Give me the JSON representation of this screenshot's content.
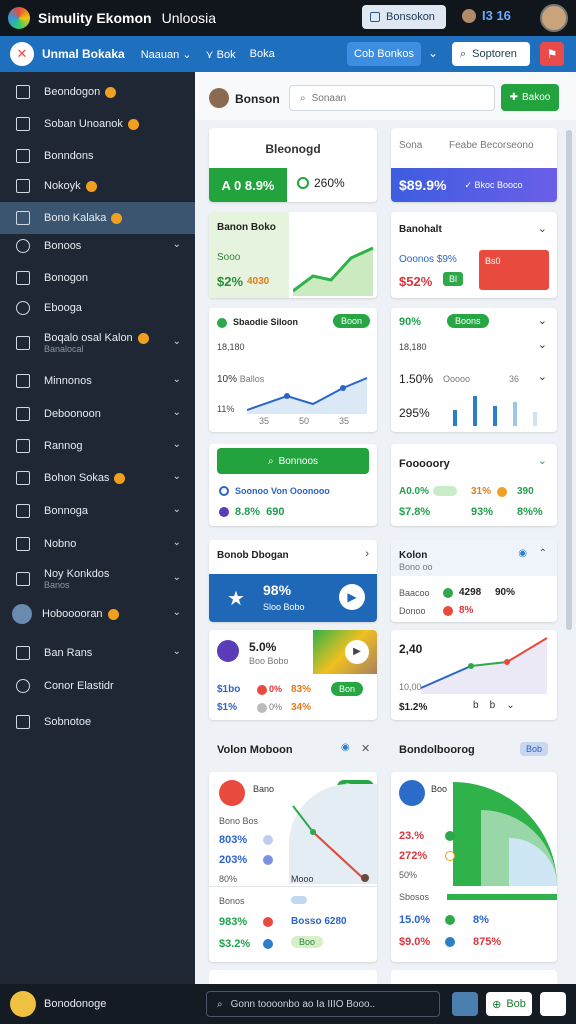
{
  "topbar": {
    "title": "Simulity Ekomon",
    "subtitle": "Unloosia",
    "button_label": "Bonsokon",
    "badge": "I3 16"
  },
  "navbar": {
    "brand": "Unmal Bokaka",
    "links": [
      "Naauan",
      "Bok",
      "Boka"
    ],
    "button_label": "Cob Bonkos",
    "search_label": "Soptoren"
  },
  "sidebar": {
    "items": [
      {
        "label": "Beondogon"
      },
      {
        "label": "Soban Unoanok"
      },
      {
        "label": "Bonndons"
      },
      {
        "label": "Nokoyk"
      },
      {
        "label": "Bono Kalaka"
      },
      {
        "label": "Bonoos"
      },
      {
        "label": "Bonogon"
      },
      {
        "label": "Ebooga"
      },
      {
        "label": "Boqalo osal Kalon",
        "sub": "Banalocal"
      },
      {
        "label": "Minnonos"
      },
      {
        "label": "Deboonoon"
      },
      {
        "label": "Rannog"
      },
      {
        "label": "Bohon Sokas"
      },
      {
        "label": "Bonnoga"
      },
      {
        "label": "Nobno"
      },
      {
        "label": "Noy Konkdos",
        "sub": "Banos"
      },
      {
        "label": "Hobooooran"
      },
      {
        "label": "Ban Rans"
      },
      {
        "label": "Conor Elastidr"
      },
      {
        "label": "Sobnotoe"
      }
    ]
  },
  "header": {
    "user": "Bonson",
    "search_placeholder": "Sonaan",
    "action_label": "Bakoo"
  },
  "cards": {
    "c1": {
      "title": "Bleonogd",
      "v1": "A 0 8.9%",
      "v2": "260%"
    },
    "c2": {
      "t1": "Sona",
      "t2": "Feabe Becorseono",
      "value": "$89.9%",
      "tag": "Bkoc Booco"
    },
    "c3": {
      "title": "Banon Boko",
      "sub": "Sooo",
      "v1": "$2%",
      "v2": "4030"
    },
    "c4": {
      "title": "Banohalt",
      "r1": "Ooonos",
      "r1v": "$9%",
      "v": "$52%",
      "chip": "Bl",
      "chip2": "Bs0"
    },
    "c5": {
      "title": "Sbaodie Siloon",
      "pill": "Boon",
      "r1": "18,180",
      "r2": "10%",
      "r2b": "Ballos",
      "r3": "11%",
      "x": [
        "35",
        "50",
        "35"
      ]
    },
    "c6": {
      "v1": "90%",
      "pill": "Boons",
      "r1": "18,180",
      "big": "1.50%",
      "big_b": "Ooooo",
      "big_c": "36",
      "v2": "295%"
    },
    "c7": {
      "button": "Bonnoos",
      "r1": "Soonoo Von Ooonooo",
      "r2": "8.8%",
      "r2b": "690"
    },
    "c8": {
      "title": "Fooooory",
      "a1": "A0.0%",
      "a2": "31%",
      "a3": "390",
      "b1": "$7.8%",
      "b2": "93%",
      "b3": "8%%"
    },
    "c9": {
      "title": "Bonob Dbogan",
      "v": "98%",
      "sub": "Sloo Bobo"
    },
    "c10": {
      "title": "Kolon",
      "sub": "Bono oo",
      "r1": "Baacoo",
      "r1v": "4298",
      "r1w": "90%",
      "r2": "Donoo",
      "r2v": "8%"
    },
    "c11": {
      "v": "5.0%",
      "sub": "Boo Bobo",
      "a1": "$1bo",
      "a2": "0%",
      "a3": "83%",
      "a4": "Bon",
      "b1": "$1%",
      "b2": "0%",
      "b3": "34%"
    },
    "c12": {
      "v": "2,40",
      "axis": "10,00",
      "foot": "$1.2%"
    },
    "sec1": {
      "title": "Volon Moboon"
    },
    "sec2": {
      "title": "Bondolboorog",
      "chip": "Bob"
    },
    "c13": {
      "top": "Bano",
      "pill": "Boon",
      "label": "Bono Bos",
      "v1": "803%",
      "v2": "203%",
      "v3": "80%",
      "v4": "Mooo",
      "foot": "Bonos",
      "f1": "983%",
      "f2": "Bosso 6280",
      "f3": "$3.2%",
      "f4": "Boo"
    },
    "c14": {
      "top": "Boo",
      "v1": "23.%",
      "v2": "272%",
      "v3": "50%",
      "foot": "Sbosos",
      "f1": "15.0%",
      "f2": "8%",
      "f3": "$9.0%",
      "f4": "875%"
    }
  },
  "bottombar": {
    "user": "Bonodonoge",
    "search": "Gonn toooonbo ao Ia IIIO Booo..",
    "btn": "Bob"
  }
}
